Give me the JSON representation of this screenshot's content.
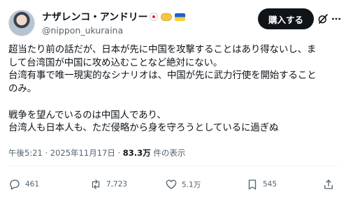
{
  "author": {
    "display_name": "ナザレンコ・アンドリー",
    "handle": "@nippon_ukuraina",
    "badges": [
      "japan-flag-icon",
      "handshake-icon",
      "ukraine-flag-icon"
    ]
  },
  "header_actions": {
    "buy_label": "購入する",
    "grok_icon": "grok-icon",
    "more_icon": "more-icon"
  },
  "tweet": {
    "lines": [
      "超当たり前の話だが、日本が先に中国を攻撃することはあり得ないし、ま",
      "して台湾国が中国に攻め込むことなど絶対にない。",
      "台湾有事で唯一現実的なシナリオは、中国が先に武力行使を開始すること",
      "のみ。",
      "",
      "戦争を望んでいるのは中国人であり、",
      "台湾人も日本人も、ただ侵略から身を守ろうとしているに過ぎぬ"
    ]
  },
  "meta": {
    "timestamp": "午後5:21 · 2025年11月17日 · ",
    "views": "83.3万",
    "views_suffix": " 件の表示"
  },
  "actions": {
    "reply_count": "461",
    "repost_count": "7,723",
    "like_count": "5.1万",
    "bookmark_count": "545"
  },
  "colors": {
    "text": "#0f1419",
    "secondary": "#536471",
    "button_bg": "#0f1419"
  }
}
